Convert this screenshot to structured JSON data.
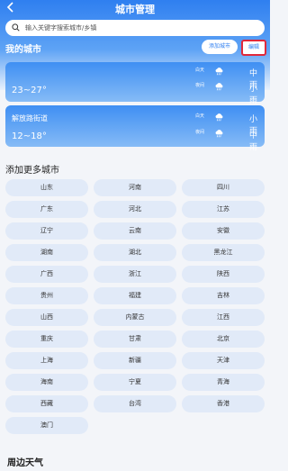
{
  "header": {
    "title": "城市管理",
    "back_icon": "chevron-left-icon"
  },
  "search": {
    "placeholder": "输入关键字搜索城市/乡镇",
    "value": ""
  },
  "my_city": {
    "label": "我的城市",
    "add_label": "添加城市",
    "edit_label": "编辑",
    "cards": [
      {
        "name": "",
        "temp": "23~27°",
        "day_label": "白天",
        "day_cond": "中雨",
        "day_icon": "rain-cloud-icon",
        "night_label": "夜间",
        "night_cond": "小雨",
        "night_icon": "rain-cloud-icon"
      },
      {
        "name": "解放路街道",
        "temp": "12~18°",
        "day_label": "白天",
        "day_cond": "小雨",
        "day_icon": "rain-cloud-icon",
        "night_label": "夜间",
        "night_cond": "中雨",
        "night_icon": "rain-cloud-icon"
      }
    ]
  },
  "add_more": {
    "label": "添加更多城市",
    "provinces": [
      "山东",
      "河南",
      "四川",
      "广东",
      "河北",
      "江苏",
      "辽宁",
      "云南",
      "安徽",
      "湖南",
      "湖北",
      "黑龙江",
      "广西",
      "浙江",
      "陕西",
      "贵州",
      "福建",
      "吉林",
      "山西",
      "内蒙古",
      "江西",
      "重庆",
      "甘肃",
      "北京",
      "上海",
      "新疆",
      "天津",
      "海南",
      "宁夏",
      "青海",
      "西藏",
      "台湾",
      "香港",
      "澳门"
    ]
  },
  "nearby": {
    "label": "周边天气"
  },
  "colors": {
    "primary": "#2f7ff0",
    "highlight_border": "#e0283b",
    "chip_bg": "#e1eaf8"
  }
}
